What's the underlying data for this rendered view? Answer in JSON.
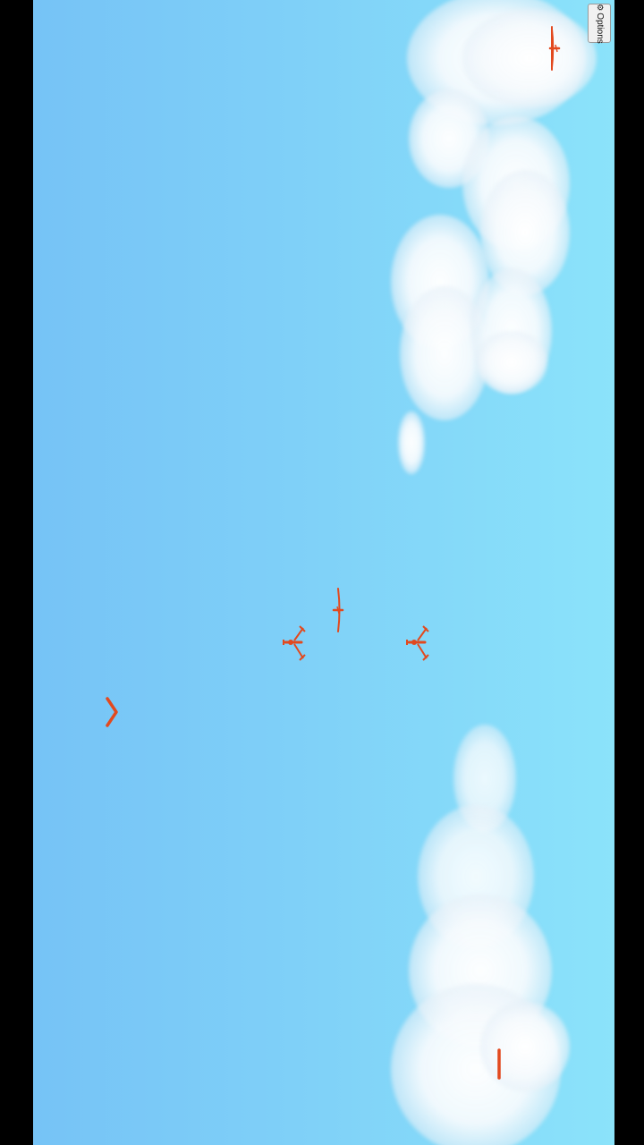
{
  "game": {
    "options_label": "Options",
    "options_icon": "gear-icon",
    "colors": {
      "sky_top": "#76c3f6",
      "sky_bottom": "#8be3fa",
      "aircraft": "#e2491e",
      "cloud": "#ffffff"
    },
    "sprites": [
      "player-aircraft",
      "enemy-aircraft",
      "enemy-aircraft",
      "enemy-aircraft",
      "enemy-aircraft",
      "enemy-chevron",
      "bullet"
    ]
  }
}
